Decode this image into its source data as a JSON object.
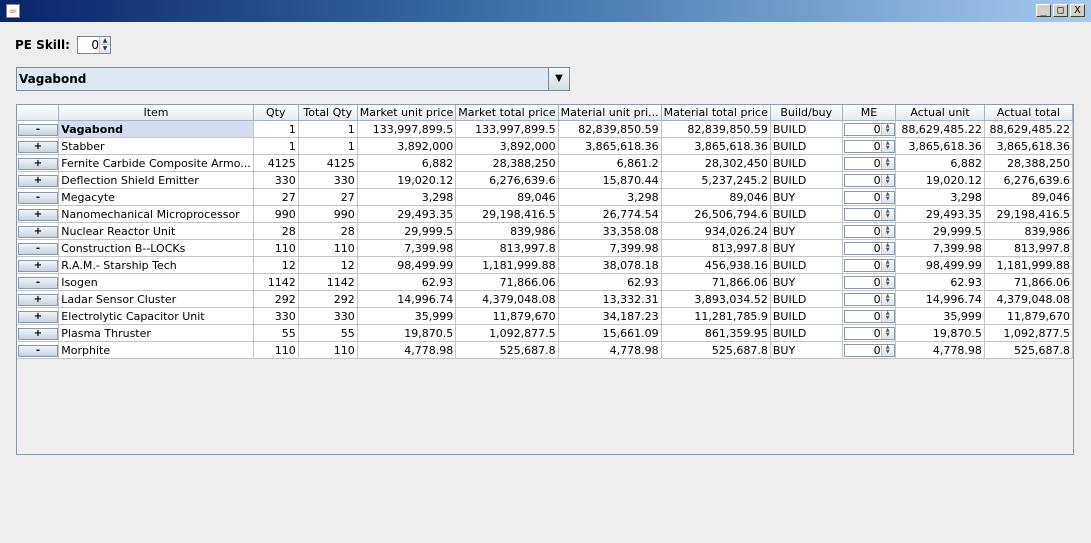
{
  "window": {
    "icon": "java-cup-icon",
    "controls": [
      "_",
      "□",
      "X"
    ]
  },
  "pe_skill": {
    "label": "PE Skill:",
    "value": "0"
  },
  "blueprint_select": {
    "value": "Vagabond"
  },
  "table": {
    "columns": [
      "",
      "Item",
      "Qty",
      "Total Qty",
      "Market unit price",
      "Market total price",
      "Material unit pri...",
      "Material total price",
      "Build/buy",
      "ME",
      "Actual unit",
      "Actual total"
    ],
    "rows": [
      {
        "toggle": "-",
        "item": "Vagabond",
        "qty": "1",
        "total_qty": "1",
        "market_unit": "133,997,899.5",
        "market_total": "133,997,899.5",
        "material_unit": "82,839,850.59",
        "material_total": "82,839,850.59",
        "build_buy": "BUILD",
        "me": "0",
        "actual_unit": "88,629,485.22",
        "actual_total": "88,629,485.22"
      },
      {
        "toggle": "+",
        "item": "Stabber",
        "qty": "1",
        "total_qty": "1",
        "market_unit": "3,892,000",
        "market_total": "3,892,000",
        "material_unit": "3,865,618.36",
        "material_total": "3,865,618.36",
        "build_buy": "BUILD",
        "me": "0",
        "actual_unit": "3,865,618.36",
        "actual_total": "3,865,618.36"
      },
      {
        "toggle": "+",
        "item": "Fernite Carbide Composite Armo...",
        "qty": "4125",
        "total_qty": "4125",
        "market_unit": "6,882",
        "market_total": "28,388,250",
        "material_unit": "6,861.2",
        "material_total": "28,302,450",
        "build_buy": "BUILD",
        "me": "0",
        "actual_unit": "6,882",
        "actual_total": "28,388,250"
      },
      {
        "toggle": "+",
        "item": "Deflection Shield Emitter",
        "qty": "330",
        "total_qty": "330",
        "market_unit": "19,020.12",
        "market_total": "6,276,639.6",
        "material_unit": "15,870.44",
        "material_total": "5,237,245.2",
        "build_buy": "BUILD",
        "me": "0",
        "actual_unit": "19,020.12",
        "actual_total": "6,276,639.6"
      },
      {
        "toggle": "-",
        "item": "Megacyte",
        "qty": "27",
        "total_qty": "27",
        "market_unit": "3,298",
        "market_total": "89,046",
        "material_unit": "3,298",
        "material_total": "89,046",
        "build_buy": "BUY",
        "me": "0",
        "actual_unit": "3,298",
        "actual_total": "89,046"
      },
      {
        "toggle": "+",
        "item": "Nanomechanical Microprocessor",
        "qty": "990",
        "total_qty": "990",
        "market_unit": "29,493.35",
        "market_total": "29,198,416.5",
        "material_unit": "26,774.54",
        "material_total": "26,506,794.6",
        "build_buy": "BUILD",
        "me": "0",
        "actual_unit": "29,493.35",
        "actual_total": "29,198,416.5"
      },
      {
        "toggle": "+",
        "item": "Nuclear Reactor Unit",
        "qty": "28",
        "total_qty": "28",
        "market_unit": "29,999.5",
        "market_total": "839,986",
        "material_unit": "33,358.08",
        "material_total": "934,026.24",
        "build_buy": "BUY",
        "me": "0",
        "actual_unit": "29,999.5",
        "actual_total": "839,986"
      },
      {
        "toggle": "-",
        "item": "Construction B--LOCKs",
        "qty": "110",
        "total_qty": "110",
        "market_unit": "7,399.98",
        "market_total": "813,997.8",
        "material_unit": "7,399.98",
        "material_total": "813,997.8",
        "build_buy": "BUY",
        "me": "0",
        "actual_unit": "7,399.98",
        "actual_total": "813,997.8"
      },
      {
        "toggle": "+",
        "item": "R.A.M.- Starship Tech",
        "qty": "12",
        "total_qty": "12",
        "market_unit": "98,499.99",
        "market_total": "1,181,999.88",
        "material_unit": "38,078.18",
        "material_total": "456,938.16",
        "build_buy": "BUILD",
        "me": "0",
        "actual_unit": "98,499.99",
        "actual_total": "1,181,999.88"
      },
      {
        "toggle": "-",
        "item": "Isogen",
        "qty": "1142",
        "total_qty": "1142",
        "market_unit": "62.93",
        "market_total": "71,866.06",
        "material_unit": "62.93",
        "material_total": "71,866.06",
        "build_buy": "BUY",
        "me": "0",
        "actual_unit": "62.93",
        "actual_total": "71,866.06"
      },
      {
        "toggle": "+",
        "item": "Ladar Sensor Cluster",
        "qty": "292",
        "total_qty": "292",
        "market_unit": "14,996.74",
        "market_total": "4,379,048.08",
        "material_unit": "13,332.31",
        "material_total": "3,893,034.52",
        "build_buy": "BUILD",
        "me": "0",
        "actual_unit": "14,996.74",
        "actual_total": "4,379,048.08"
      },
      {
        "toggle": "+",
        "item": "Electrolytic Capacitor Unit",
        "qty": "330",
        "total_qty": "330",
        "market_unit": "35,999",
        "market_total": "11,879,670",
        "material_unit": "34,187.23",
        "material_total": "11,281,785.9",
        "build_buy": "BUILD",
        "me": "0",
        "actual_unit": "35,999",
        "actual_total": "11,879,670"
      },
      {
        "toggle": "+",
        "item": "Plasma Thruster",
        "qty": "55",
        "total_qty": "55",
        "market_unit": "19,870.5",
        "market_total": "1,092,877.5",
        "material_unit": "15,661.09",
        "material_total": "861,359.95",
        "build_buy": "BUILD",
        "me": "0",
        "actual_unit": "19,870.5",
        "actual_total": "1,092,877.5"
      },
      {
        "toggle": "-",
        "item": "Morphite",
        "qty": "110",
        "total_qty": "110",
        "market_unit": "4,778.98",
        "market_total": "525,687.8",
        "material_unit": "4,778.98",
        "material_total": "525,687.8",
        "build_buy": "BUY",
        "me": "0",
        "actual_unit": "4,778.98",
        "actual_total": "525,687.8"
      }
    ]
  }
}
